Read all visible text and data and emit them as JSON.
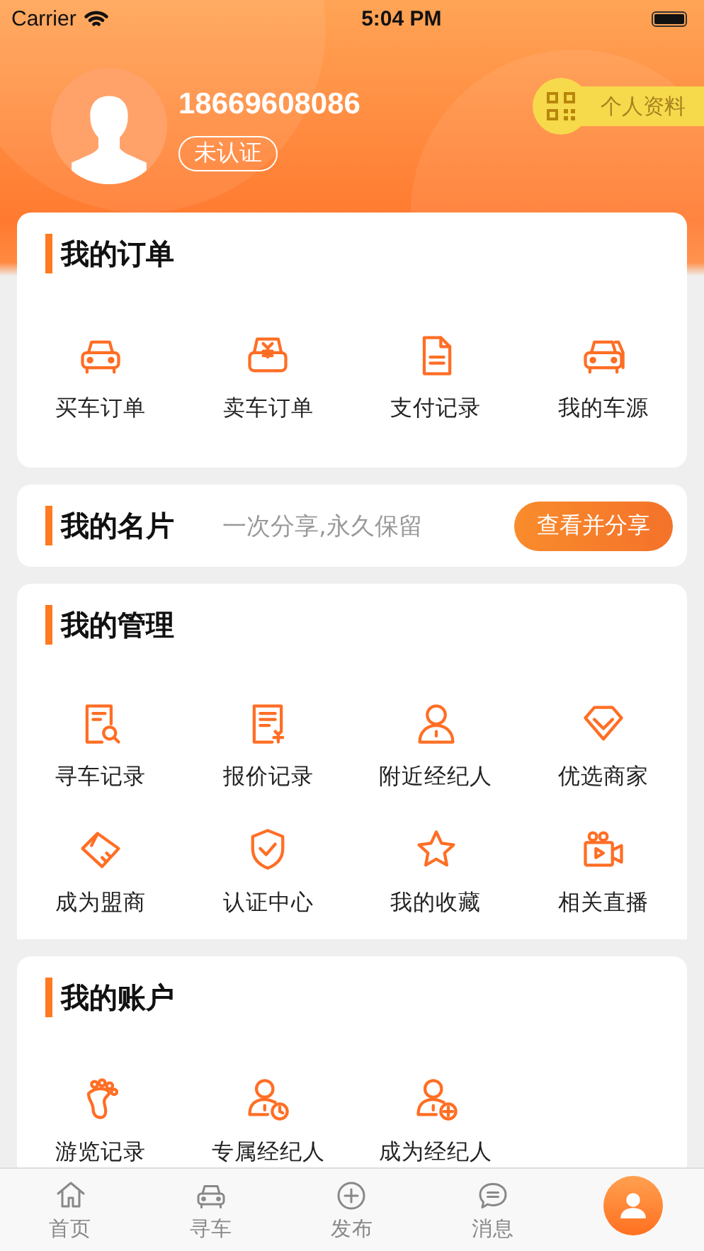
{
  "status_bar": {
    "carrier": "Carrier",
    "time": "5:04 PM"
  },
  "profile": {
    "phone": "18669608086",
    "verification": "未认证",
    "profile_button": "个人资料"
  },
  "orders": {
    "title": "我的订单",
    "items": [
      {
        "label": "买车订单"
      },
      {
        "label": "卖车订单"
      },
      {
        "label": "支付记录"
      },
      {
        "label": "我的车源"
      }
    ]
  },
  "card": {
    "title": "我的名片",
    "slogan": "一次分享,永久保留",
    "button": "查看并分享"
  },
  "management": {
    "title": "我的管理",
    "items": [
      {
        "label": "寻车记录"
      },
      {
        "label": "报价记录"
      },
      {
        "label": "附近经纪人"
      },
      {
        "label": "优选商家"
      },
      {
        "label": "成为盟商"
      },
      {
        "label": "认证中心"
      },
      {
        "label": "我的收藏"
      },
      {
        "label": "相关直播"
      }
    ]
  },
  "account": {
    "title": "我的账户",
    "items": [
      {
        "label": "游览记录"
      },
      {
        "label": "专属经纪人"
      },
      {
        "label": "成为经纪人"
      }
    ]
  },
  "tab_bar": [
    {
      "label": "首页",
      "selected": false
    },
    {
      "label": "寻车",
      "selected": false
    },
    {
      "label": "发布",
      "selected": false
    },
    {
      "label": "消息",
      "selected": false
    },
    {
      "selected": true
    }
  ]
}
